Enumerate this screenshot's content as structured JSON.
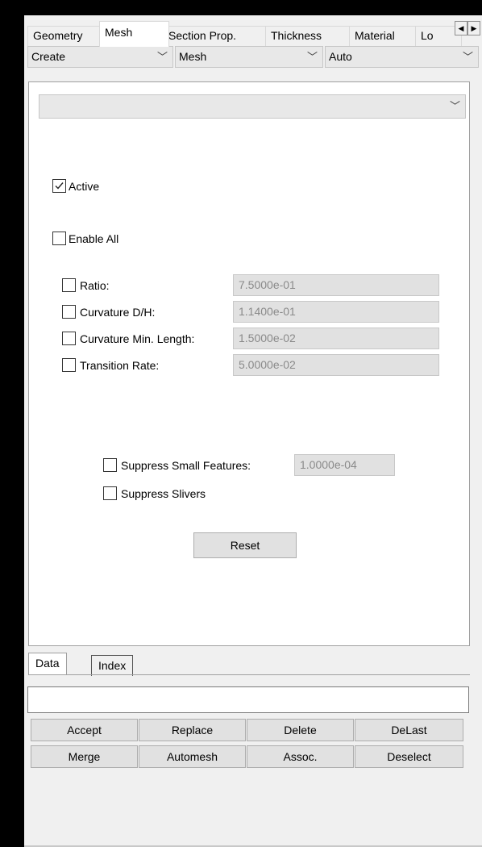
{
  "tabs": [
    "Geometry",
    "Mesh",
    "Section Prop.",
    "Thickness",
    "Material",
    "Lo"
  ],
  "selected_tab": "Mesh",
  "dropdowns": {
    "action": "Create",
    "object": "Mesh",
    "method": "Auto",
    "group": ""
  },
  "options": {
    "active_label": "Active",
    "active_checked": true,
    "enable_all_label": "Enable All",
    "enable_all_checked": false,
    "rows": [
      {
        "label": "Ratio:",
        "value": "7.5000e-01"
      },
      {
        "label": "Curvature D/H:",
        "value": "1.1400e-01"
      },
      {
        "label": "Curvature Min. Length:",
        "value": "1.5000e-02"
      },
      {
        "label": "Transition Rate:",
        "value": "5.0000e-02"
      }
    ],
    "suppress_small_label": "Suppress Small Features:",
    "suppress_small_value": "1.0000e-04",
    "suppress_slivers_label": "Suppress Slivers",
    "reset_label": "Reset"
  },
  "bottom_tabs": [
    "Data",
    "Index"
  ],
  "input_value": "",
  "buttons": {
    "accept": "Accept",
    "replace": "Replace",
    "delete": "Delete",
    "delast": "DeLast",
    "merge": "Merge",
    "automesh": "Automesh",
    "assoc": "Assoc.",
    "deselect": "Deselect"
  },
  "colors": {
    "window_bg": "#f0f0f0",
    "panel_bg": "#ffffff",
    "disabled_field_bg": "#e1e1e1",
    "disabled_text": "#8a8a8a"
  }
}
